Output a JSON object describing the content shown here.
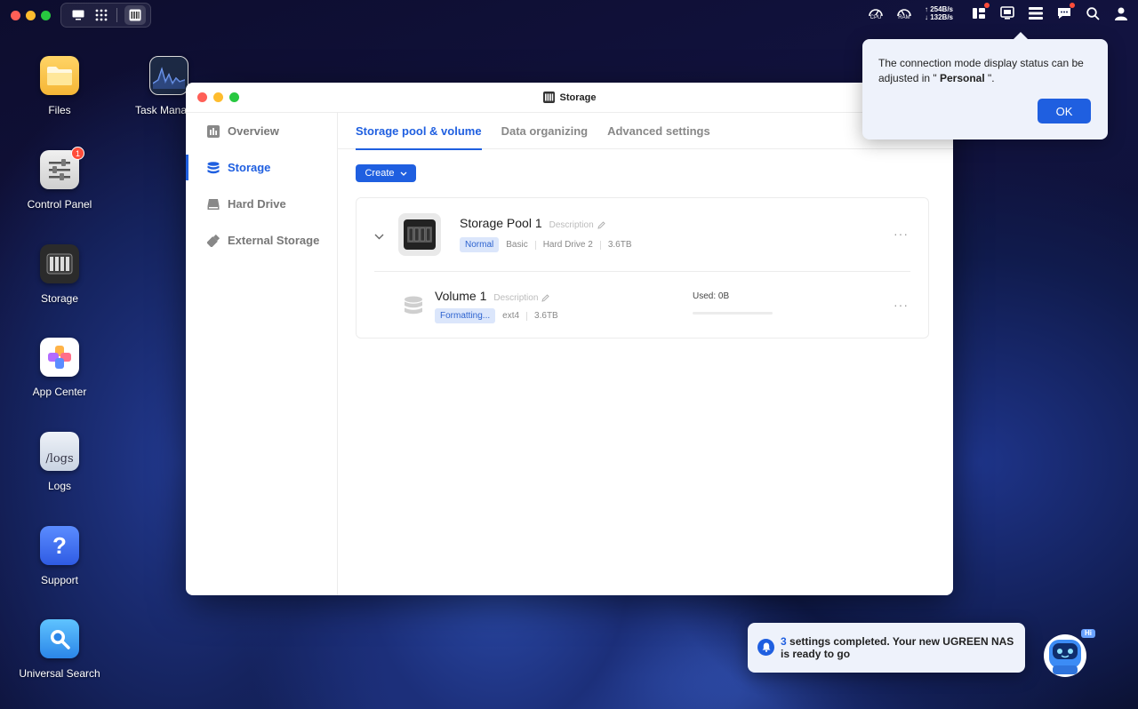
{
  "topbar": {
    "cpu_label": "CPU",
    "ram_label": "RAM",
    "net_up": "254B/s",
    "net_down": "132B/s"
  },
  "desktop": {
    "icons": [
      {
        "label": "Files"
      },
      {
        "label": "Task Mana"
      },
      {
        "label": "Control Panel",
        "badge": "1"
      },
      {
        "label": "Storage"
      },
      {
        "label": "App Center"
      },
      {
        "label": "Logs",
        "tile_text": "/logs"
      },
      {
        "label": "Support",
        "tile_text": "?"
      },
      {
        "label": "Universal Search"
      }
    ]
  },
  "window": {
    "title": "Storage",
    "sidebar": [
      {
        "label": "Overview"
      },
      {
        "label": "Storage"
      },
      {
        "label": "Hard Drive"
      },
      {
        "label": "External Storage"
      }
    ],
    "tabs": [
      {
        "label": "Storage pool & volume"
      },
      {
        "label": "Data organizing"
      },
      {
        "label": "Advanced settings"
      }
    ],
    "create_label": "Create",
    "pool": {
      "name": "Storage Pool 1",
      "description": "Description",
      "status": "Normal",
      "raid": "Basic",
      "drive": "Hard Drive 2",
      "size": "3.6TB",
      "more": "···"
    },
    "volume": {
      "name": "Volume 1",
      "description": "Description",
      "status": "Formatting...",
      "fs": "ext4",
      "size": "3.6TB",
      "used": "Used: 0B",
      "used_fraction": 0,
      "more": "···"
    }
  },
  "popover": {
    "message_prefix": "The connection mode display status can be adjusted in \"",
    "message_bold": " Personal ",
    "message_suffix": "\".",
    "ok_label": "OK"
  },
  "notification": {
    "count": "3",
    "text": " settings completed. Your new UGREEN NAS is ready to go"
  },
  "mascot": {
    "greeting": "Hi"
  },
  "colors": {
    "accent": "#1f5fe0",
    "badge": "#ff4d3a"
  }
}
